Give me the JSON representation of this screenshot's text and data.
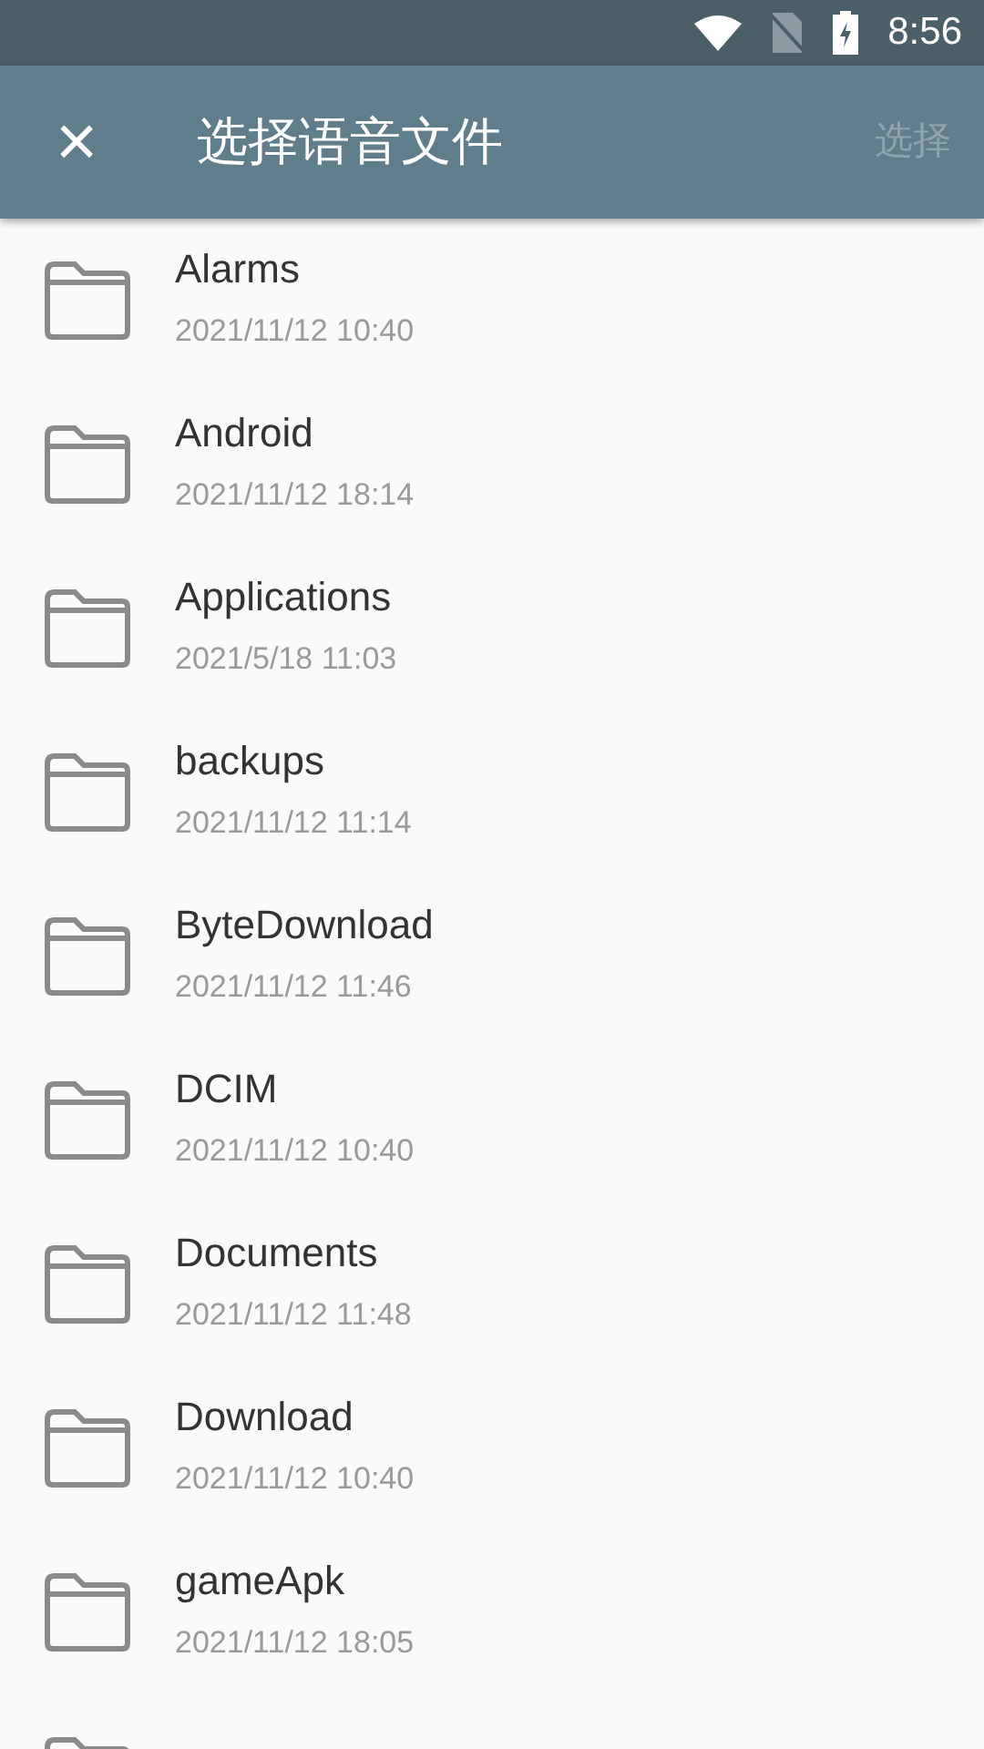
{
  "status_bar": {
    "time": "8:56"
  },
  "toolbar": {
    "close_icon": "×",
    "title": "选择语音文件",
    "action": {
      "label": "选择",
      "disabled": true
    }
  },
  "files": [
    {
      "name": "Alarms",
      "date": "2021/11/12 10:40"
    },
    {
      "name": "Android",
      "date": "2021/11/12 18:14"
    },
    {
      "name": "Applications",
      "date": "2021/5/18 11:03"
    },
    {
      "name": "backups",
      "date": "2021/11/12 11:14"
    },
    {
      "name": "ByteDownload",
      "date": "2021/11/12 11:46"
    },
    {
      "name": "DCIM",
      "date": "2021/11/12 10:40"
    },
    {
      "name": "Documents",
      "date": "2021/11/12 11:48"
    },
    {
      "name": "Download",
      "date": "2021/11/12 10:40"
    },
    {
      "name": "gameApk",
      "date": "2021/11/12 18:05"
    }
  ],
  "more_below": true
}
